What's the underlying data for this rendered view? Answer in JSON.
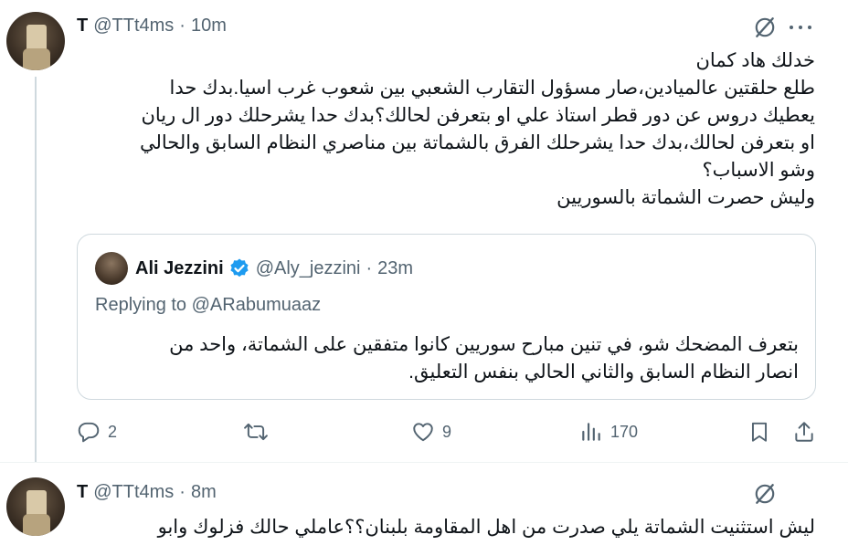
{
  "tweets": [
    {
      "author_name": "T",
      "handle": "@TTt4ms",
      "separator": "·",
      "time": "10m",
      "lines": [
        "خدلك هاد كمان",
        "طلع حلقتين عالميادين،صار مسؤول التقارب الشعبي بين شعوب غرب اسيا.بدك حدا",
        "يعطيك دروس عن دور قطر استاذ علي او بتعرفن لحالك؟بدك حدا يشرحلك دور ال ريان",
        "او بتعرفن لحالك،بدك حدا يشرحلك الفرق بالشماتة بين مناصري النظام السابق والحالي",
        "وشو الاسباب؟",
        "وليش حصرت الشماتة بالسوريين"
      ],
      "quote": {
        "author_name": "Ali Jezzini",
        "handle": "@Aly_jezzini",
        "separator": "·",
        "time": "23m",
        "replying_prefix": "Replying to",
        "replying_to": "@ARabumuaaz",
        "lines": [
          "بتعرف المضحك شو، في تنين مبارح سوريين كانوا متفقين على الشماتة، واحد من",
          "انصار النظام السابق والثاني الحالي بنفس التعليق."
        ]
      },
      "actions": {
        "reply_count": "2",
        "retweet_count": "",
        "like_count": "9",
        "views_count": "170"
      }
    },
    {
      "author_name": "T",
      "handle": "@TTt4ms",
      "separator": "·",
      "time": "8m",
      "lines": [
        "ليش استثنيت الشماتة يلي صدرت من اهل المقاومة بلبنان؟؟عاملي حالك فزلوك وابو"
      ]
    }
  ],
  "icons": {
    "grok": "grok-icon",
    "more": "more-icon",
    "reply": "reply-icon",
    "retweet": "retweet-icon",
    "like": "heart-icon",
    "views": "views-icon",
    "bookmark": "bookmark-icon",
    "share": "share-icon",
    "verified": "verified-badge-icon"
  },
  "colors": {
    "text": "#0f1419",
    "secondary": "#536471",
    "border": "#cfd9de",
    "verified": "#1d9bf0"
  }
}
